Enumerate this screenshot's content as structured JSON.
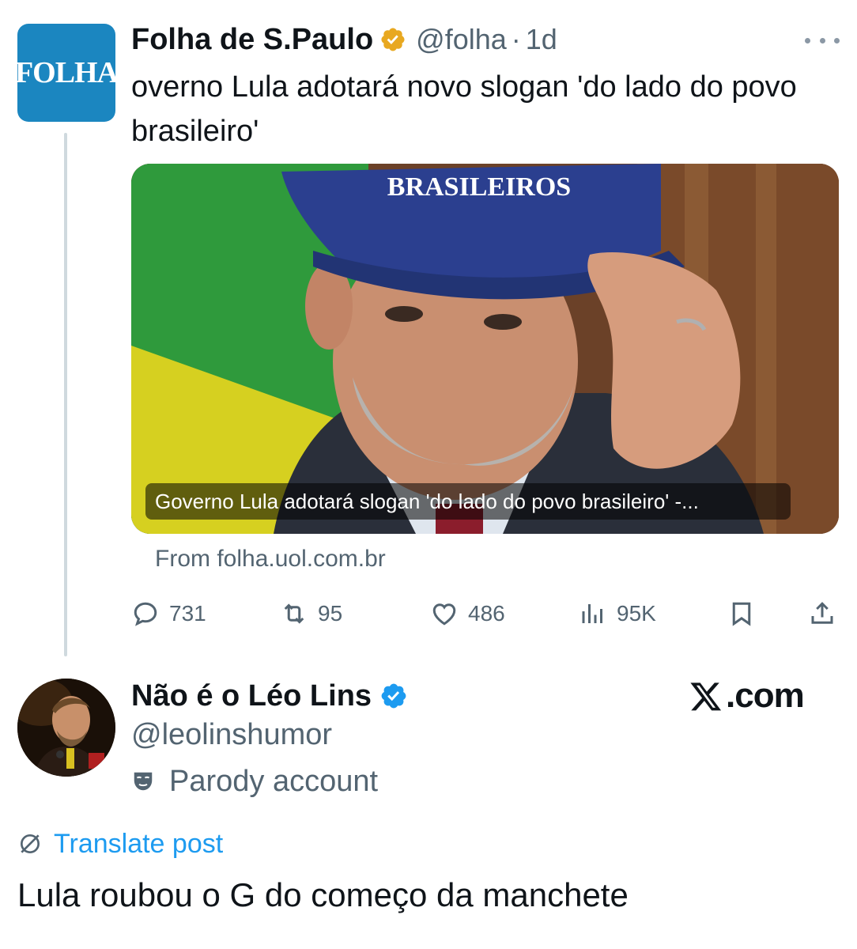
{
  "quoted_tweet": {
    "avatar_text": "FOLHA",
    "author_name": "Folha de S.Paulo",
    "verified_badge": "gold-check-icon",
    "handle": "@folha",
    "separator": "·",
    "time": "1d",
    "more_icon": "more-horizontal-icon",
    "text": "overno Lula adotará novo slogan 'do lado do povo brasileiro'",
    "card": {
      "image_text": "BRASILEIROS",
      "title": "Governo Lula adotará slogan 'do lado do povo brasileiro' -...",
      "source": "From folha.uol.com.br"
    },
    "actions": {
      "reply": {
        "icon": "reply-icon",
        "count": "731"
      },
      "retweet": {
        "icon": "retweet-icon",
        "count": "95"
      },
      "like": {
        "icon": "heart-icon",
        "count": "486"
      },
      "views": {
        "icon": "views-icon",
        "count": "95K"
      },
      "bookmark": {
        "icon": "bookmark-icon"
      },
      "share": {
        "icon": "share-icon"
      }
    }
  },
  "reply_tweet": {
    "author_name": "Não é o Léo Lins",
    "verified_badge": "blue-check-icon",
    "watermark": ".com",
    "watermark_icon": "x-logo-icon",
    "handle": "@leolinshumor",
    "parody_icon": "mask-icon",
    "parody_label": "Parody account",
    "translate_icon": "globe-icon",
    "translate_label": "Translate post",
    "text": "Lula roubou o G do começo da manchete"
  },
  "colors": {
    "accent": "#1d9bf0",
    "secondary_text": "#536471",
    "primary_text": "#0f1419",
    "folha_blue": "#1b86c0",
    "gold_badge": "#e8a820"
  }
}
